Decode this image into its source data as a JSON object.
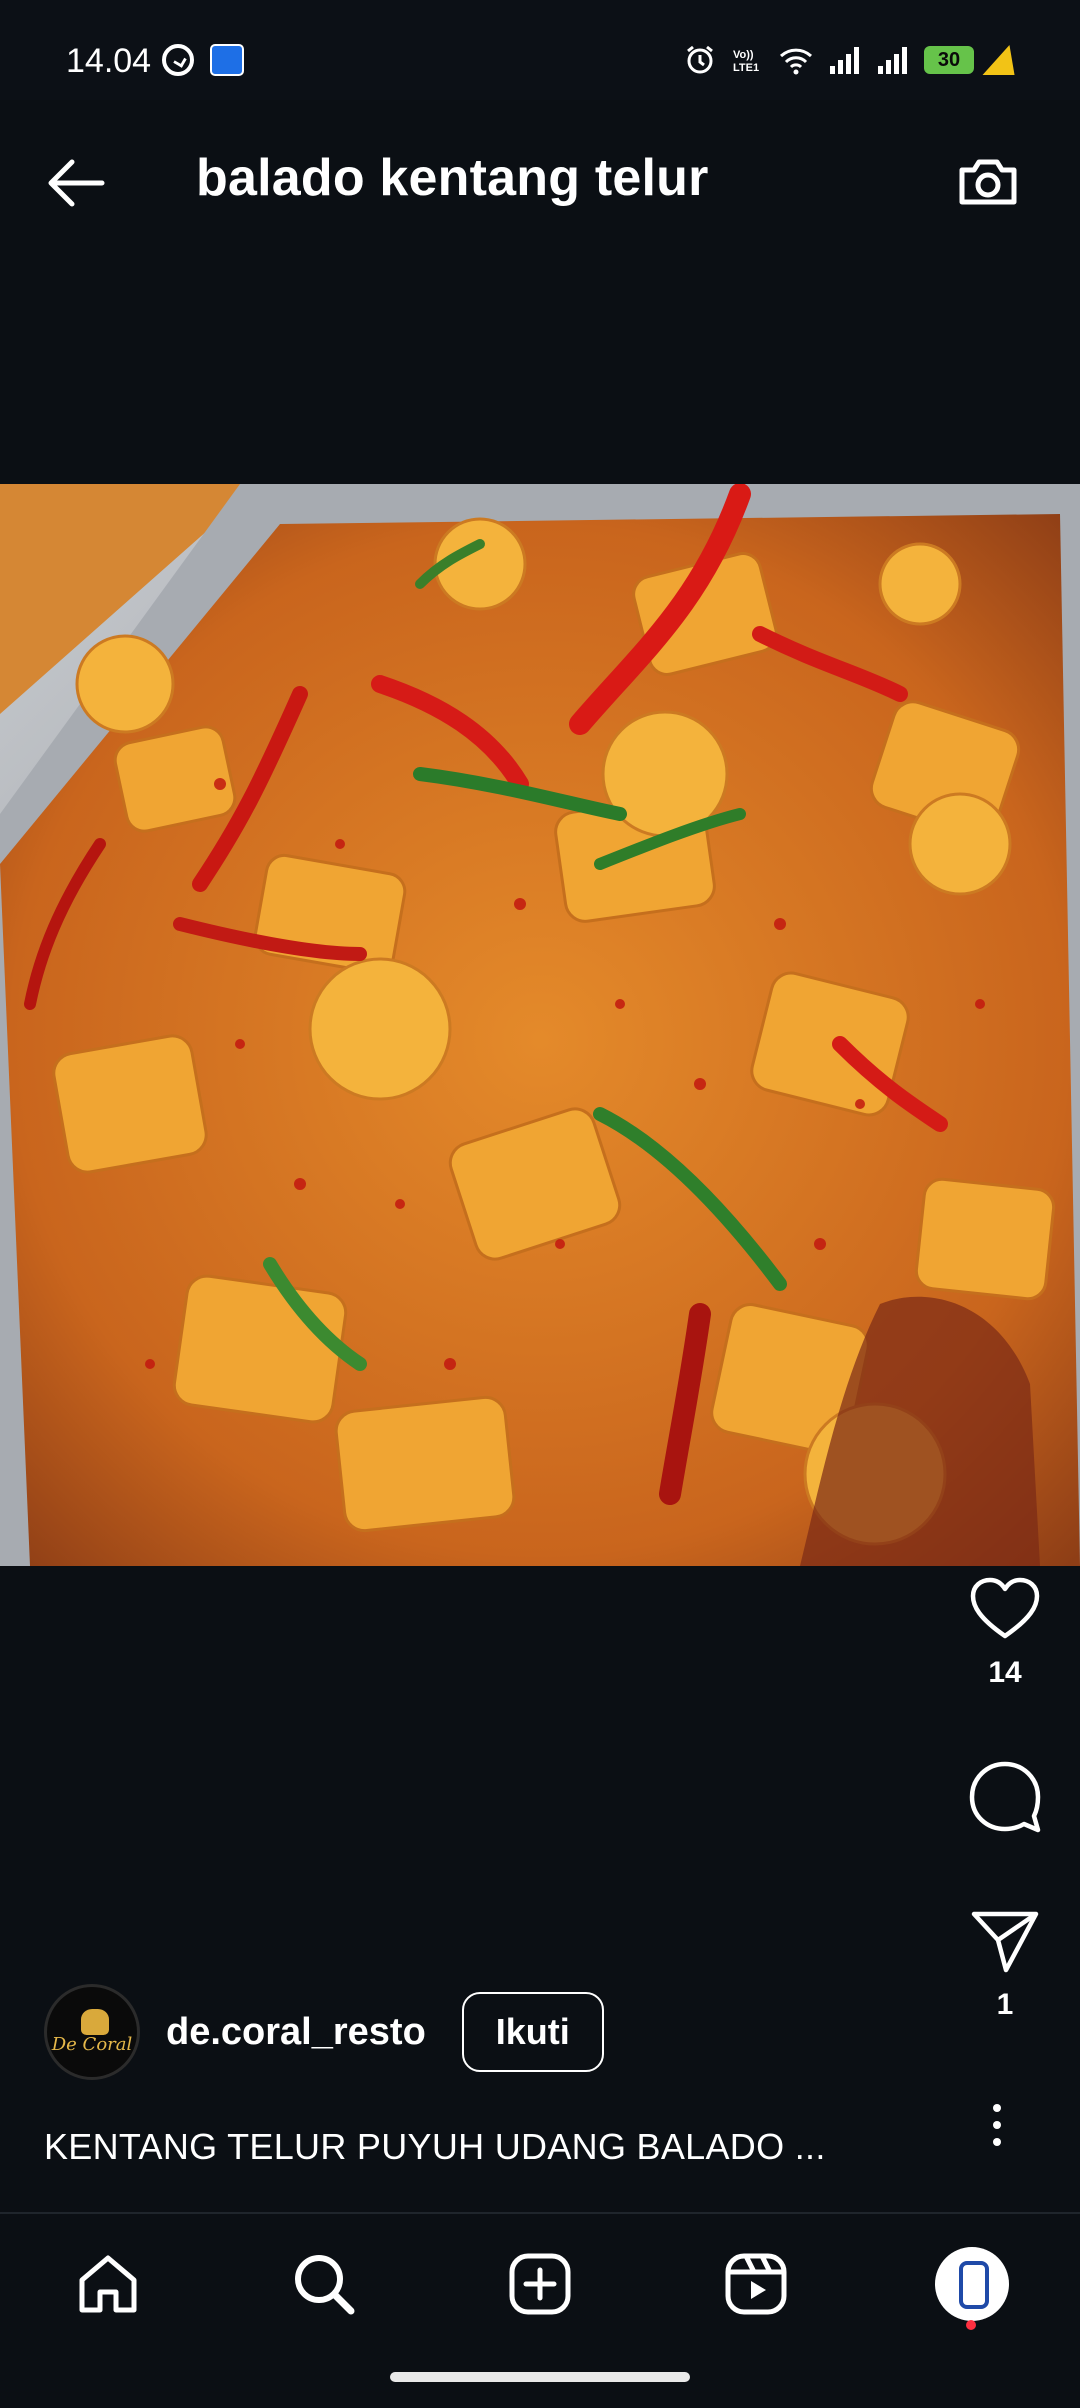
{
  "status_bar": {
    "time": "14.04",
    "battery": "30",
    "icons": [
      "whatsapp-icon",
      "app-notification-icon",
      "alarm-icon",
      "volte-icon",
      "wifi-icon",
      "signal-icon",
      "signal-icon",
      "battery-icon",
      "charging-icon"
    ],
    "volte_label": "Vo))\nLTE1"
  },
  "header": {
    "title": "balado kentang telur",
    "back_icon": "arrow-left-icon",
    "camera_icon": "camera-icon"
  },
  "post": {
    "likes": "14",
    "shares": "1",
    "username": "de.coral_resto",
    "avatar_text": "De Coral",
    "follow_label": "Ikuti",
    "caption": "KENTANG TELUR PUYUH UDANG BALADO ..."
  },
  "colors": {
    "background": "#0b0f14",
    "text": "#ffffff",
    "notification": "#ff3040"
  },
  "bottom_nav": {
    "items": [
      "home-icon",
      "search-icon",
      "create-icon",
      "reels-icon",
      "profile-avatar"
    ]
  }
}
